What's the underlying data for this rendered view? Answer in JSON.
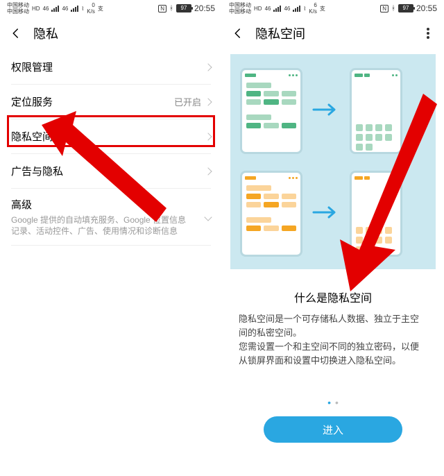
{
  "status": {
    "carrier": "中国移动",
    "hd": "HD",
    "net1": "46",
    "net2": "46",
    "wifi": "WiFi",
    "speed_val": "0",
    "speed_unit": "K/s",
    "speed_val2": "6",
    "pay_icon": "支",
    "nfc": "N",
    "battery_pct": "97",
    "time": "20:55"
  },
  "screen1": {
    "title": "隐私",
    "rows": {
      "perm": "权限管理",
      "loc": "定位服务",
      "loc_value": "已开启",
      "privspace": "隐私空间",
      "ads": "广告与隐私",
      "advanced": "高级",
      "advanced_sub": "Google 提供的自动填充服务、Google 位置信息记录、活动控件、广告、使用情况和诊断信息"
    }
  },
  "screen2": {
    "title": "隐私空间",
    "info_title": "什么是隐私空间",
    "info_p1": "隐私空间是一个可存储私人数据、独立于主空间的私密空间。",
    "info_p2": "您需设置一个和主空间不同的独立密码，以便从锁屏界面和设置中切换进入隐私空间。",
    "enter": "进入"
  }
}
